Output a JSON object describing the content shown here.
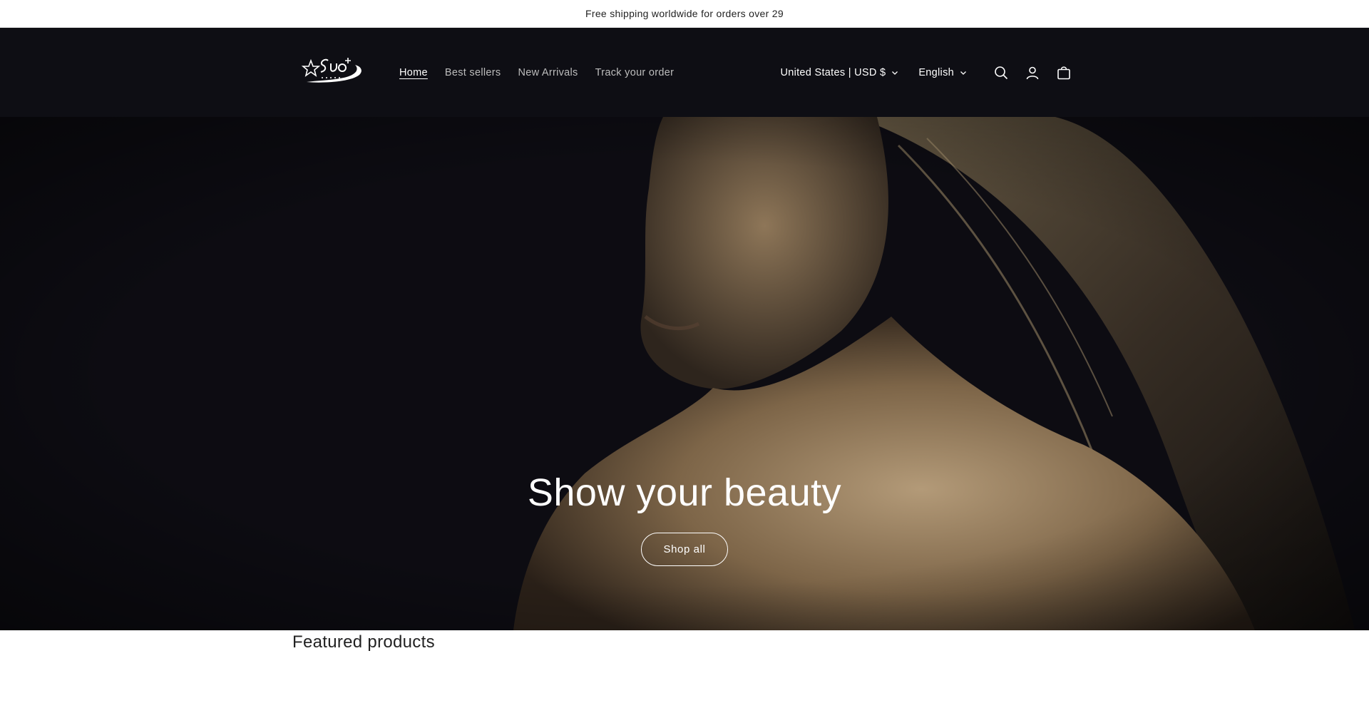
{
  "announcement": {
    "text": "Free shipping worldwide for orders over 29"
  },
  "header": {
    "logo_icon": "suo-star-logo",
    "nav": [
      {
        "label": "Home",
        "active": true
      },
      {
        "label": "Best sellers",
        "active": false
      },
      {
        "label": "New Arrivals",
        "active": false
      },
      {
        "label": "Track your order",
        "active": false
      }
    ],
    "country_selector": "United States | USD $",
    "language_selector": "English",
    "icons": [
      "search-icon",
      "account-icon",
      "cart-icon"
    ]
  },
  "hero": {
    "title": "Show your beauty",
    "button_label": "Shop all"
  },
  "featured": {
    "title": "Featured products"
  },
  "colors": {
    "header_bg": "#0e0e14",
    "hero_bg": "#0d0c12",
    "text_dark": "#222222",
    "nav_inactive": "#bdbdbd",
    "white": "#ffffff"
  }
}
